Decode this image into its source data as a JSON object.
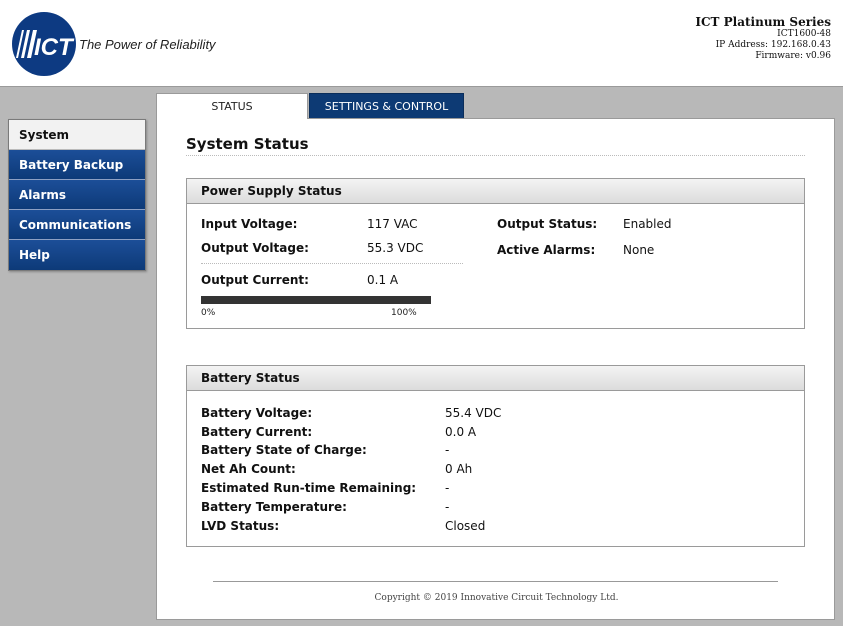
{
  "header": {
    "logo_text": "ICT",
    "tagline": "The Power of Reliability",
    "series": "ICT Platinum Series",
    "model": "ICT1600-48",
    "ip": "IP Address: 192.168.0.43",
    "firmware": "Firmware: v0.96"
  },
  "tabs": [
    {
      "label": "STATUS",
      "active": true
    },
    {
      "label": "SETTINGS & CONTROL",
      "active": false
    }
  ],
  "sidebar": {
    "items": [
      {
        "label": "System",
        "active": true
      },
      {
        "label": "Battery Backup"
      },
      {
        "label": "Alarms"
      },
      {
        "label": "Communications"
      },
      {
        "label": "Help"
      }
    ]
  },
  "page": {
    "title": "System Status"
  },
  "power_supply": {
    "title": "Power Supply Status",
    "input_voltage_label": "Input Voltage:",
    "input_voltage": "117 VAC",
    "output_voltage_label": "Output Voltage:",
    "output_voltage": "55.3 VDC",
    "output_current_label": "Output Current:",
    "output_current": "0.1 A",
    "output_status_label": "Output Status:",
    "output_status": "Enabled",
    "active_alarms_label": "Active Alarms:",
    "active_alarms": "None",
    "current_bar": {
      "fraction": 0.0,
      "min_label": "0%",
      "max_label": "100%"
    }
  },
  "battery": {
    "title": "Battery Status",
    "rows": [
      {
        "label": "Battery Voltage:",
        "value": "55.4 VDC"
      },
      {
        "label": "Battery Current:",
        "value": "0.0 A"
      },
      {
        "label": "Battery State of Charge:",
        "value": "-"
      },
      {
        "label": "Net Ah Count:",
        "value": "0 Ah"
      },
      {
        "label": "Estimated Run-time Remaining:",
        "value": "-"
      },
      {
        "label": "Battery Temperature:",
        "value": "-"
      },
      {
        "label": "LVD Status:",
        "value": "Closed"
      }
    ]
  },
  "footer": {
    "copyright": "Copyright © 2019 Innovative Circuit Technology Ltd."
  },
  "colors": {
    "brand_navy": "#0d3a78",
    "background": "#b8b8b8"
  }
}
